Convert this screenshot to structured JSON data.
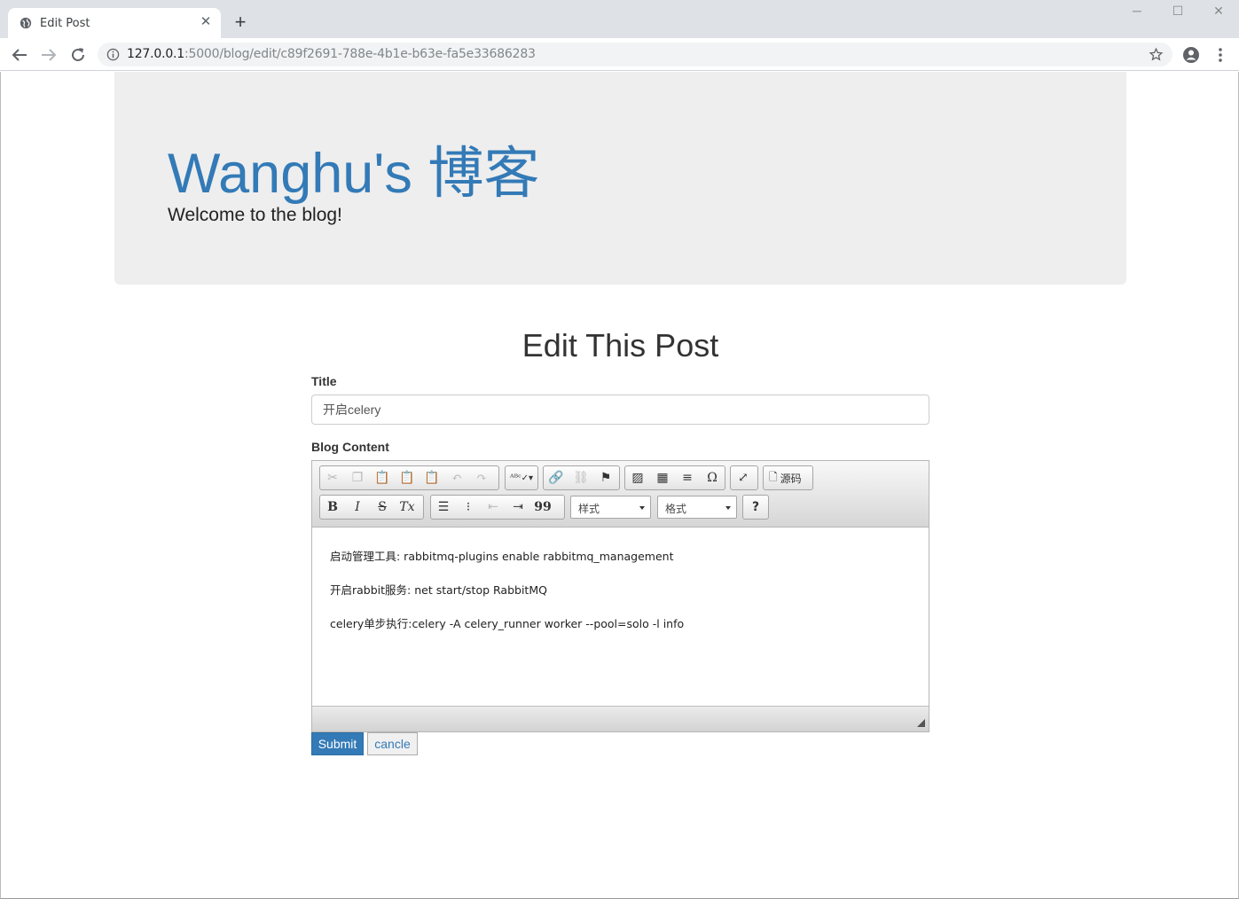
{
  "browser": {
    "tab_title": "Edit Post",
    "url_host": "127.0.0.1",
    "url_path": ":5000/blog/edit/c89f2691-788e-4b1e-b63e-fa5e33686283"
  },
  "jumbotron": {
    "site_title": "Wanghu's 博客",
    "subtitle": "Welcome to the blog!"
  },
  "form": {
    "heading": "Edit This Post",
    "title_label": "Title",
    "title_value": "开启celery",
    "content_label": "Blog Content",
    "submit_label": "Submit",
    "cancel_label": "cancle"
  },
  "editor": {
    "source_label": "源码",
    "styles_combo": "样式",
    "format_combo": "格式",
    "help_label": "?",
    "bold_label": "B",
    "italic_label": "I",
    "strike_label": "S",
    "clear_format_label": "Tx",
    "special_char_label": "Ω",
    "quote_label": "99",
    "paragraphs": [
      "启动管理工具: rabbitmq-plugins enable rabbitmq_management",
      "开启rabbit服务: net start/stop RabbitMQ",
      "celery单步执行:celery -A celery_runner worker --pool=solo -l info"
    ]
  },
  "colors": {
    "brand": "#337ab7",
    "jumbotron_bg": "#eeeeee"
  }
}
